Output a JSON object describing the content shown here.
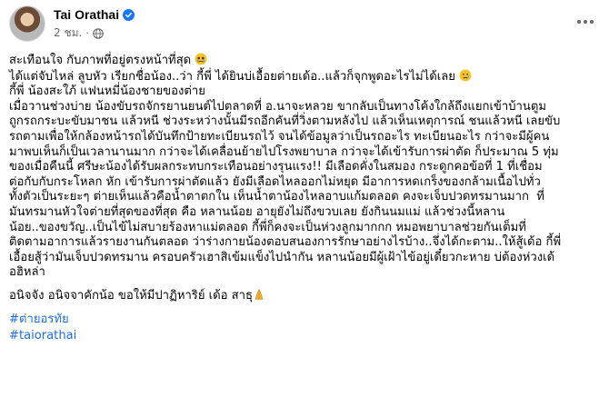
{
  "post": {
    "author": "Tai Orathai",
    "time": "2 ชม.",
    "icons": {
      "verified": "verified-badge-icon",
      "audience": "globe-icon",
      "more": "more-options-icon"
    },
    "colors": {
      "link": "#216fdb",
      "verified": "#1877f2",
      "muted": "#65676b"
    },
    "body": {
      "line1": "สะเทือนใจ กับภาพที่อยู่ตรงหน้าที่สุด",
      "line2": "ได้แต่จับไหล่ ลูบหัว เรียกชื่อน้อง..ว่า กี้พี่ ได้ยินบ่เอื้อยต่ายเด้อ..แล้วก็จุกพูดอะไรไม่ได้เลย",
      "line3": "กี้พี่ น้องสะใภ้ แฟนหมี่น้องชายของต่าย",
      "paragraph": "เมื่อวานช่วงบ่าย น้องขับรถจักรยานยนต์ไปตลาดที่ อ.นาจะหลวย ขากลับเป็นทางโค้งใกล้ถึงแยกเข้าบ้านตูม\nถูกรถกระบะขับมาชน แล้วหนี ช่วงระหว่างนั้นมีรถอีกคันที่วิ่งตามหลังไป แล้วเห็นเหตุการณ์ ชนแล้วหนี เลยขับ\nรถตามเพื่อให้กล้องหน้ารถได้บันทึกป้ายทะเบียนรถไว้ จนได้ข้อมูลว่าเป็นรถอะไร ทะเบียนอะไร กว่าจะมีผู้คน\nมาพบเห็นก็เป็นเวลานานมาก กว่าจะได้เคลื่อนย้ายไปโรงพยาบาล กว่าจะได้เข้ารับการผ่าตัด ก็ประมาณ 5 ทุ่ม\nของเมื่อคืนนี้ ศรีษะน้องได้รับผลกระทบกระเทือนอย่างรุนแรง!! มีเลือดคั่งในสมอง กระดูกคอข้อที่ 1 ที่เชื่อม\nต่อกับกับกระโหลก หัก เข้ารับการผ่าตัดแล้ว ยังมีเลือดไหลออกไม่หยุด มีอาการหดเกร็งของกล้ามเนื้อไปทั่ว\nทั้งตัวเป็นระยะๆ ต่ายเห็นแล้วคือน้ำตาตกใน เห็นน้ำตาน้องไหลอาบแก้มตลอด คงจะเจ็บปวดทรมานมาก  ที่\nมันทรมานหัวใจต่ายที่สุดของที่สุด คือ หลานน้อย อายุยังไม่ถึงขวบเลย ยังกินนมแม่ แล้วช่วงนี้หลาน\nน้อย..ของขวัญ..เป็นไข้ไม่สบายร้องหาแม่ตลอด กี้พี่ก็คงจะเป็นห่วงลูกมากกก หมอพยาบาลช่วยกันเต็มที่\nติดตามอาการแล้วรายงานกันตลอด ว่าร่างกายน้องตอบสนองการรักษาอย่างไรบ้าง..จึ่งได้กะตาม..ให้สู้เด้อ กี้พี่\nเอื้อยสู้ว่ามันเจ็บปวดทรมาน ครอบครัวเฮาสิเข้มแข็งไปนำกัน หลานน้อยมีผู้เฝ้าไข้อยู่เดี๋ยวกะหาย บ่ต้องห่วงเด้\nอฮิหล่า",
      "closing": "อนิจจัง อนิจจาคักน้อ ขอให้มีปาฏิหาริย์ เด้อ สาธุ"
    },
    "hashtags": [
      "#ต่ายอรทัย",
      "#taiorathai"
    ]
  }
}
